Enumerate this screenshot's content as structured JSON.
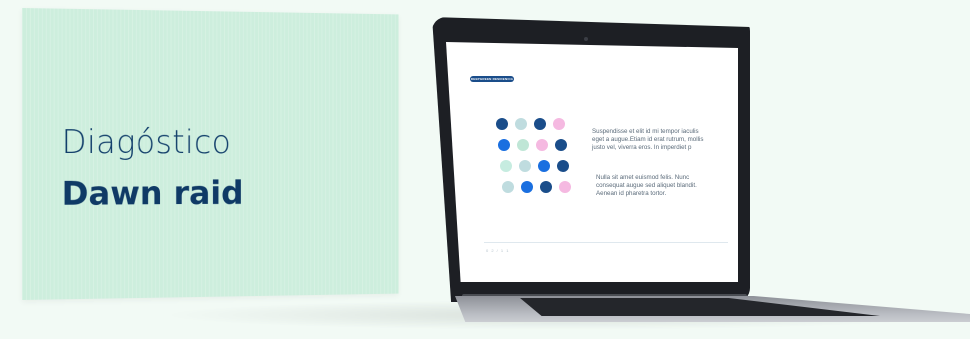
{
  "card": {
    "title": "Diagóstico",
    "subtitle": "Dawn raid"
  },
  "slide": {
    "tag": "DEEPGREEN RESIDENCIA",
    "paragraph1": "Suspendisse et elit id mi tempor iaculis eget a augue.Etiam id erat rutrum, mollis justo vel, viverra eros. In imperdiet p",
    "paragraph2": "Nulla sit amet euismod felis. Nunc consequat augue sed aliquet blandit. Aenean id pharetra tortor.",
    "page_number": "0 2 / 1 1",
    "dots": [
      [
        "#1a4d8a",
        "#bfdcdf",
        "#1a4d8a",
        "#f5b9e1"
      ],
      [
        "#1a6fe0",
        "#bfe6d6",
        "#f5b9e1",
        "#1a4d8a"
      ],
      [
        "#c6ece0",
        "#bfdcdf",
        "#1a6fe0",
        "#1a4d8a"
      ],
      [
        "#bfdcdf",
        "#1a6fe0",
        "#1a4d8a",
        "#f5b9e1"
      ]
    ]
  },
  "colors": {
    "card_bg": "#cdeedd",
    "title_color": "#123f6b",
    "page_bg": "#f2faf5"
  }
}
